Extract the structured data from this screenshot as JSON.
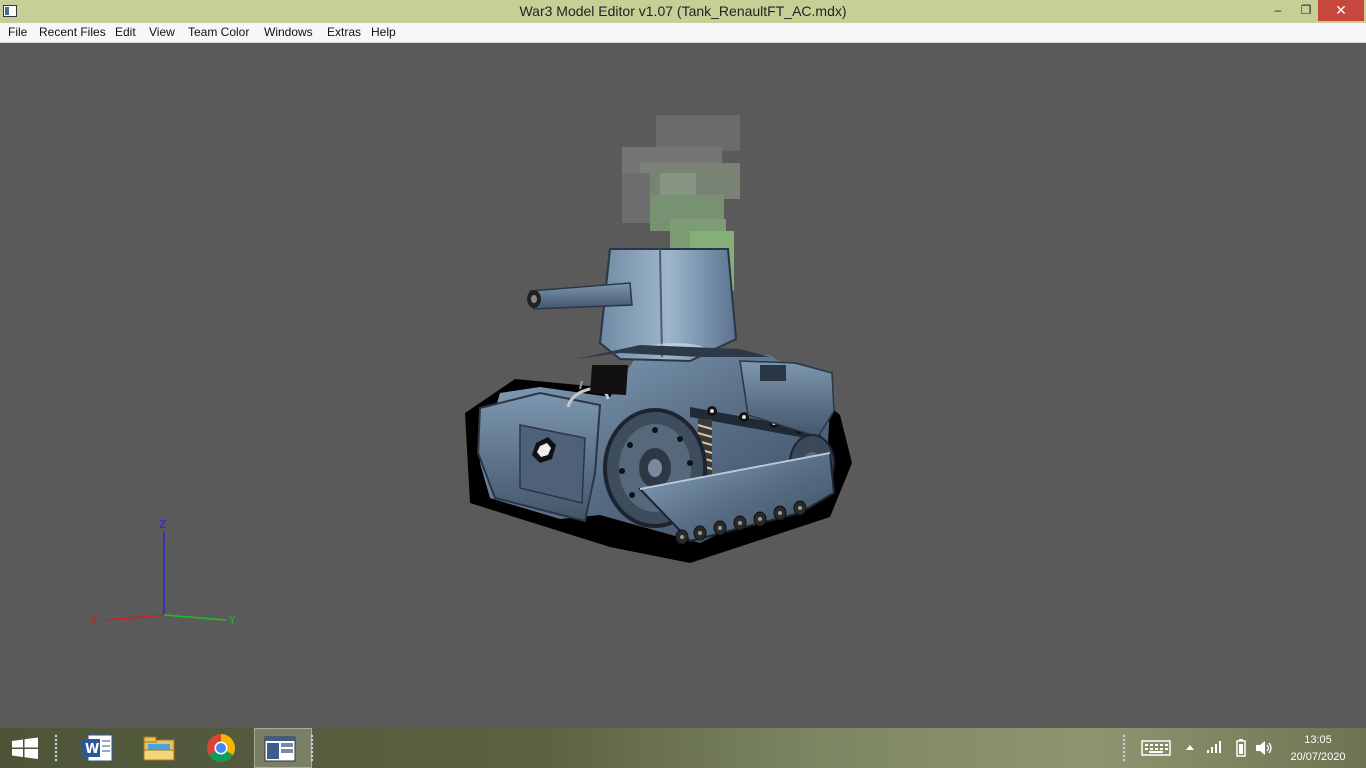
{
  "window": {
    "title": "War3 Model Editor v1.07 (Tank_RenaultFT_AC.mdx)",
    "controls": {
      "minimize": "–",
      "restore": "❐",
      "close": "✕"
    }
  },
  "menu": {
    "items": [
      "File",
      "Recent Files",
      "Edit",
      "View",
      "Team Color",
      "Windows",
      "Extras",
      "Help"
    ]
  },
  "viewport": {
    "background": "#5a5a5a",
    "axes": {
      "x": "X",
      "y": "Y",
      "z": "Z"
    },
    "axis_colors": {
      "x": "#e02020",
      "y": "#20c020",
      "z": "#2020e0"
    }
  },
  "taskbar": {
    "start_icon": "windows-logo-icon",
    "pinned": [
      {
        "name": "word-icon",
        "active": false
      },
      {
        "name": "file-explorer-icon",
        "active": false
      },
      {
        "name": "chrome-icon",
        "active": false
      },
      {
        "name": "model-editor-icon",
        "active": true
      }
    ],
    "tray": {
      "icons": [
        "keyboard-icon",
        "show-hidden-icons-icon",
        "signal-icon",
        "battery-icon",
        "volume-icon"
      ],
      "time": "13:05",
      "date": "20/07/2020"
    }
  }
}
